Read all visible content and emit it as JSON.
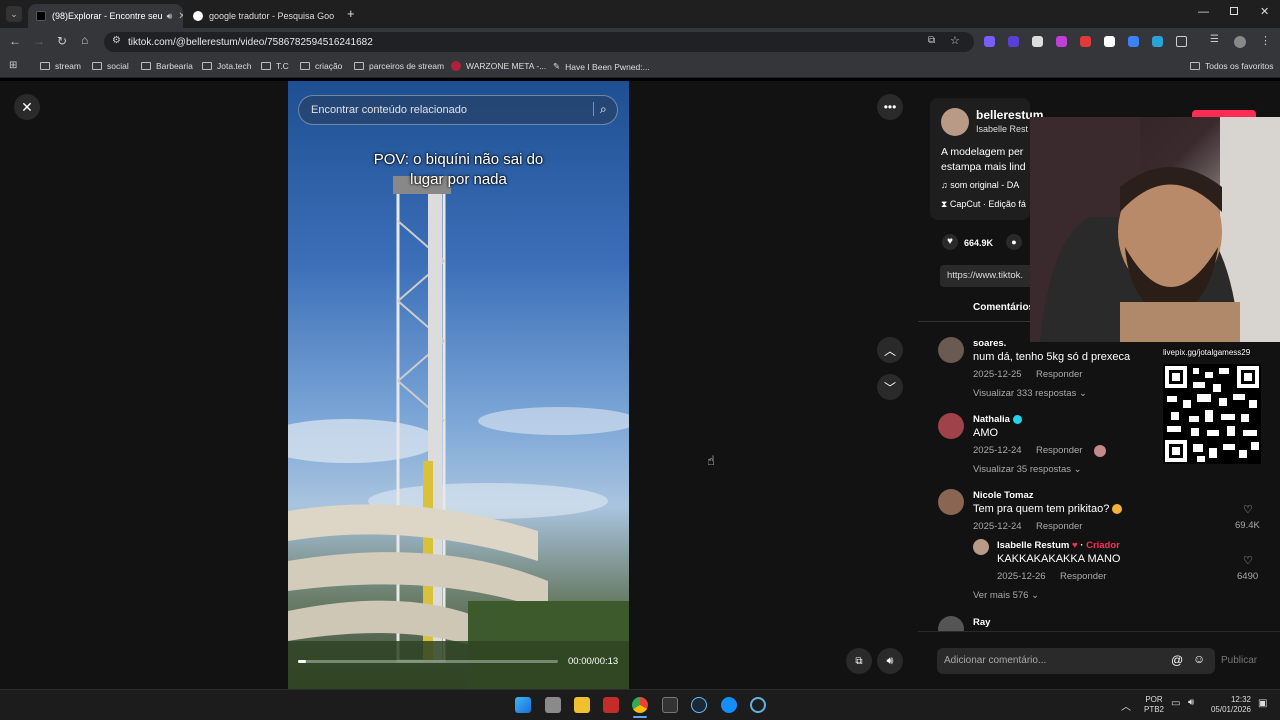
{
  "browser": {
    "tabs": [
      {
        "title": "(98)Explorar - Encontre seu"
      },
      {
        "title": "google tradutor - Pesquisa Goo"
      }
    ],
    "url": "tiktok.com/@bellerestum/video/7586782594516241682",
    "bookmarks": [
      "stream",
      "social",
      "Barbearia",
      "Jota.tech",
      "T.C",
      "criação",
      "parceiros de stream",
      "WARZONE META -...",
      "Have I Been Pwned:..."
    ],
    "all_bookmarks": "Todos os favoritos"
  },
  "video": {
    "search_placeholder": "Encontrar conteúdo relacionado",
    "caption_line1": "POV: o biquíni não sai do",
    "caption_line2": "lugar por nada",
    "time": "00:00/00:13",
    "progress": 0.03
  },
  "post": {
    "username": "bellerestum",
    "display_name": "Isabelle Rest",
    "description": "A modelagem per",
    "description2": "estampa mais lind",
    "sound": "som original - DA",
    "capcut": "CapCut · Edição fá",
    "likes": "664.9K",
    "link": "https://www.tiktok.",
    "tab_comments": "Comentários"
  },
  "comments": [
    {
      "name": "soares.",
      "text": "num dá, tenho 5kg só d prexeca",
      "date": "2025-12-25",
      "reply": "Responder",
      "more": "Visualizar 333 respostas"
    },
    {
      "name": "Nathalia",
      "text": "AMO",
      "date": "2025-12-24",
      "reply": "Responder",
      "more": "Visualizar 35 respostas"
    },
    {
      "name": "Nicole Tomaz",
      "text": "Tem pra quem tem prikitao?",
      "date": "2025-12-24",
      "reply": "Responder",
      "likes": "69.4K"
    },
    {
      "name": "Isabelle Restum",
      "creator": "Criador",
      "text": "KAKKAKAKAKKA MANO",
      "date": "2025-12-26",
      "reply": "Responder",
      "likes": "6490",
      "more": "Ver mais 576"
    },
    {
      "name": "Ray"
    }
  ],
  "comment_input": {
    "placeholder": "Adicionar comentário...",
    "publish": "Publicar"
  },
  "overlay": {
    "livepix": "livepix.gg/jotalgamess29"
  },
  "taskbar": {
    "lang1": "POR",
    "lang2": "PTB2",
    "time": "12:32",
    "date": "05/01/2026"
  },
  "colors": {
    "accent": "#fe2c55",
    "creator": "#fe2c55",
    "verified": "#20d5ec"
  }
}
